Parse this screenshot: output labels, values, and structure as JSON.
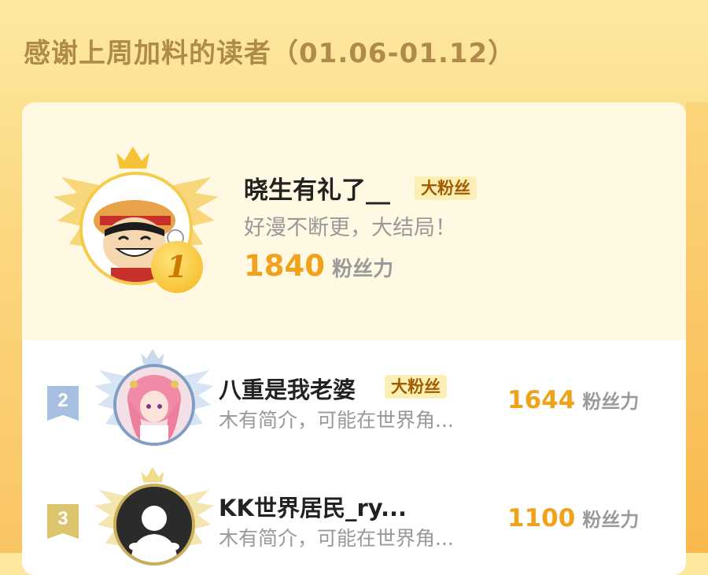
{
  "header": {
    "title": "感谢上周加料的读者（01.06-01.12）"
  },
  "ranking": [
    {
      "rank": "1",
      "name": "晓生有礼了__",
      "badge": "大粉丝",
      "bio": "好漫不断更，大结局！",
      "score": "1840",
      "unit": "粉丝力"
    },
    {
      "rank": "2",
      "name": "八重是我老婆",
      "badge": "大粉丝",
      "bio": "木有简介，可能在世界角...",
      "score": "1644",
      "unit": "粉丝力"
    },
    {
      "rank": "3",
      "name": "KK世界居民_ry...",
      "badge": "",
      "bio": "木有简介，可能在世界角...",
      "score": "1100",
      "unit": "粉丝力"
    }
  ],
  "colors": {
    "accent_score": "#f0a21a",
    "gold": "#f6c338",
    "silver": "#a7c0e2",
    "bronze": "#dcc46e",
    "badge_bg": "#fcefb6"
  },
  "icons": {
    "crown": "crown-icon",
    "wing": "wing-icon",
    "rank_medal": "rank-1-medal-icon"
  }
}
